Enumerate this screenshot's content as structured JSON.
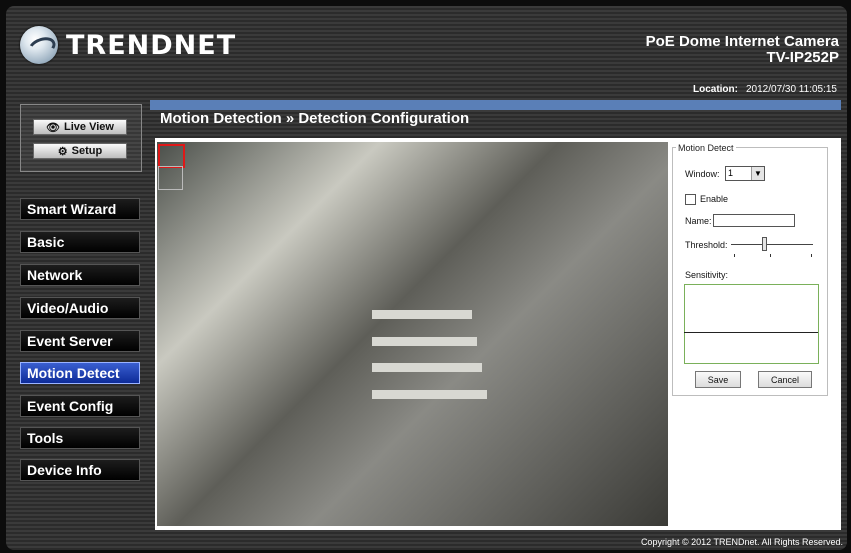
{
  "brand": {
    "logo_text": "TRENDNET"
  },
  "header": {
    "product_line": "PoE Dome Internet Camera",
    "model": "TV-IP252P",
    "location_label": "Location:",
    "datetime": "2012/07/30 11:05:15"
  },
  "view_buttons": {
    "live_view": "Live View",
    "setup": "Setup"
  },
  "menu": [
    {
      "label": "Smart Wizard"
    },
    {
      "label": "Basic"
    },
    {
      "label": "Network"
    },
    {
      "label": "Video/Audio"
    },
    {
      "label": "Event Server"
    },
    {
      "label": "Motion Detect",
      "active": true
    },
    {
      "label": "Event Config"
    },
    {
      "label": "Tools"
    },
    {
      "label": "Device Info"
    }
  ],
  "page": {
    "breadcrumb": "Motion Detection » Detection Configuration"
  },
  "motion_panel": {
    "legend": "Motion Detect",
    "window_label": "Window:",
    "window_value": "1",
    "enable_label": "Enable",
    "enable_checked": false,
    "name_label": "Name:",
    "name_value": "",
    "threshold_label": "Threshold:",
    "threshold_level": 0.45,
    "sensitivity_label": "Sensitivity:",
    "save": "Save",
    "cancel": "Cancel"
  },
  "footer": {
    "copyright": "Copyright © 2012 TRENDnet. All Rights Reserved."
  },
  "colors": {
    "accent_bar": "#5a7fb7",
    "active_menu": "#1a3bb0",
    "sensitivity_border": "#7ab05a"
  }
}
